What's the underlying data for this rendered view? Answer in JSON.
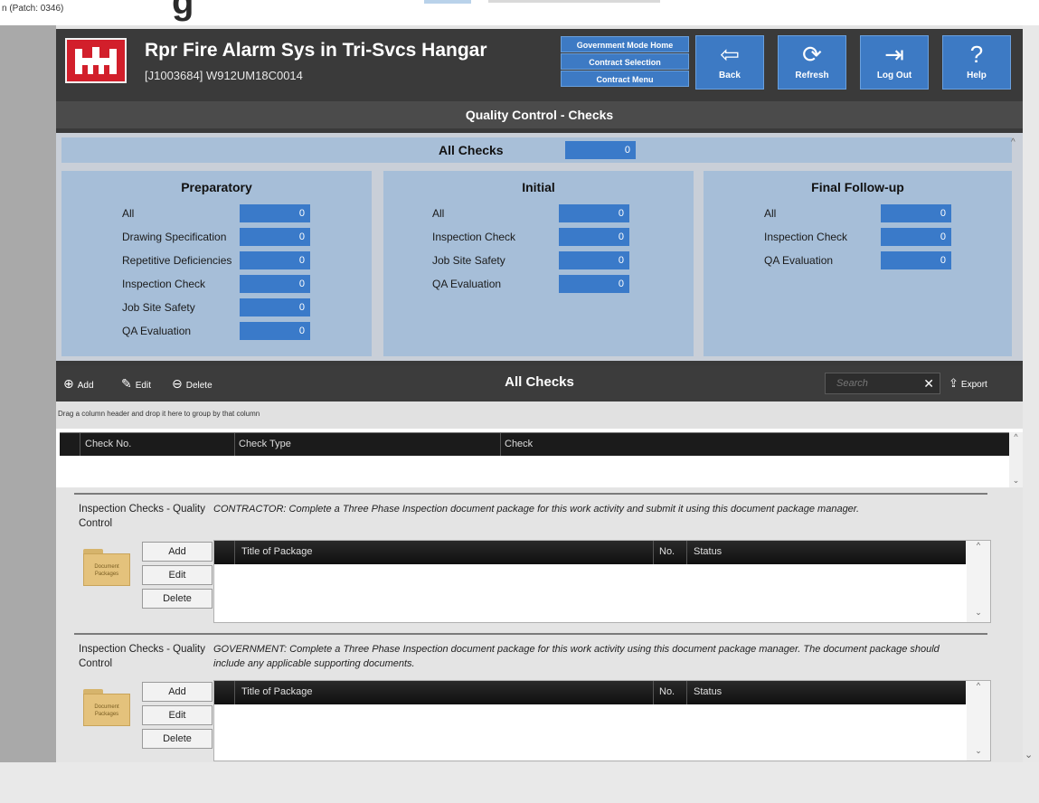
{
  "window": {
    "patch": "n (Patch: 0346)",
    "cut_title": "g"
  },
  "header": {
    "title": "Rpr Fire Alarm Sys in Tri-Svcs Hangar",
    "subtitle": "[J1003684] W912UM18C0014",
    "mode_buttons": [
      "Government Mode Home",
      "Contract Selection",
      "Contract Menu"
    ],
    "nav": [
      {
        "label": "Back",
        "icon": "back-arrow-icon",
        "glyph": "⇦"
      },
      {
        "label": "Refresh",
        "icon": "refresh-icon",
        "glyph": "⟳"
      },
      {
        "label": "Log Out",
        "icon": "logout-icon",
        "glyph": "⇥"
      },
      {
        "label": "Help",
        "icon": "help-icon",
        "glyph": "?"
      }
    ]
  },
  "page_title": "Quality Control - Checks",
  "summary": {
    "all_checks": {
      "label": "All Checks",
      "value": "0"
    },
    "preparatory": {
      "title": "Preparatory",
      "rows": [
        {
          "label": "All",
          "value": "0"
        },
        {
          "label": "Drawing Specification",
          "value": "0"
        },
        {
          "label": "Repetitive Deficiencies",
          "value": "0"
        },
        {
          "label": "Inspection Check",
          "value": "0"
        },
        {
          "label": "Job Site Safety",
          "value": "0"
        },
        {
          "label": "QA Evaluation",
          "value": "0"
        }
      ]
    },
    "initial": {
      "title": "Initial",
      "rows": [
        {
          "label": "All",
          "value": "0"
        },
        {
          "label": "Inspection Check",
          "value": "0"
        },
        {
          "label": "Job Site Safety",
          "value": "0"
        },
        {
          "label": "QA Evaluation",
          "value": "0"
        }
      ]
    },
    "final": {
      "title": "Final Follow-up",
      "rows": [
        {
          "label": "All",
          "value": "0"
        },
        {
          "label": "Inspection Check",
          "value": "0"
        },
        {
          "label": "QA Evaluation",
          "value": "0"
        }
      ]
    }
  },
  "toolbar": {
    "add": "Add",
    "edit": "Edit",
    "delete": "Delete",
    "title": "All Checks",
    "search_placeholder": "Search",
    "export": "Export"
  },
  "grid": {
    "group_hint": "Drag a column header and drop it here to group by that column",
    "columns": [
      "Check No.",
      "Check Type",
      "Check"
    ]
  },
  "contractor_section": {
    "label": "Inspection Checks - Quality Control",
    "description": "CONTRACTOR: Complete a Three Phase Inspection document package for this work activity and submit it using this document package manager.",
    "folder_label": "Document Packages",
    "buttons": [
      "Add",
      "Edit",
      "Delete"
    ],
    "columns": [
      "Title of Package",
      "No.",
      "Status"
    ]
  },
  "government_section": {
    "label": "Inspection Checks - Quality Control",
    "description": "GOVERNMENT: Complete a Three Phase Inspection document package for this work activity using this document package manager. The document package should include any applicable supporting documents.",
    "folder_label": "Document Packages",
    "buttons": [
      "Add",
      "Edit",
      "Delete"
    ],
    "columns": [
      "Title of Package",
      "No.",
      "Status"
    ]
  },
  "colors": {
    "accent_blue": "#3d7ac4",
    "panel_blue": "#a6bed8",
    "header_dark": "#3a3a3a",
    "logo_red": "#d21f2b"
  }
}
